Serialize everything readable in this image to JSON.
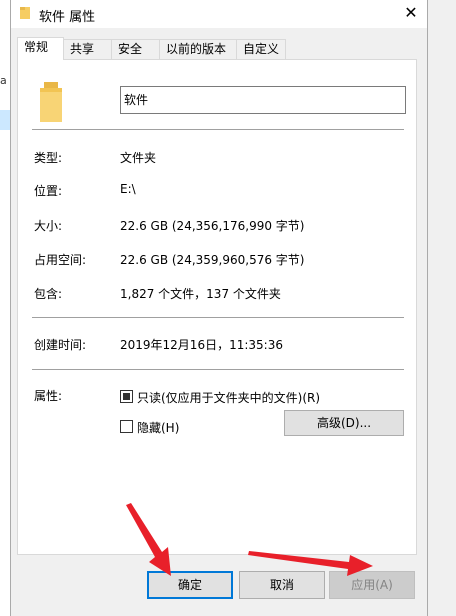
{
  "background": {
    "fragment_text": "a"
  },
  "window": {
    "title": "软件 属性",
    "close_glyph": "✕"
  },
  "tabs": [
    {
      "label": "常规",
      "active": true
    },
    {
      "label": "共享"
    },
    {
      "label": "安全"
    },
    {
      "label": "以前的版本"
    },
    {
      "label": "自定义"
    }
  ],
  "general": {
    "name_value": "软件",
    "type_label": "类型:",
    "type_value": "文件夹",
    "location_label": "位置:",
    "location_value": "E:\\",
    "size_label": "大小:",
    "size_value": "22.6 GB (24,356,176,990 字节)",
    "disk_size_label": "占用空间:",
    "disk_size_value": "22.6 GB (24,359,960,576 字节)",
    "contains_label": "包含:",
    "contains_value": "1,827 个文件，137 个文件夹",
    "created_label": "创建时间:",
    "created_value": "2019年12月16日，11:35:36",
    "attributes_label": "属性:",
    "readonly_label": "只读(仅应用于文件夹中的文件)(R)",
    "readonly_checked": true,
    "hidden_label": "隐藏(H)",
    "hidden_checked": false,
    "advanced_button": "高级(D)..."
  },
  "buttons": {
    "ok": "确定",
    "cancel": "取消",
    "apply": "应用(A)"
  },
  "colors": {
    "accent": "#0078d7",
    "arrow": "#e8202a",
    "folder": "#f6cd63"
  }
}
